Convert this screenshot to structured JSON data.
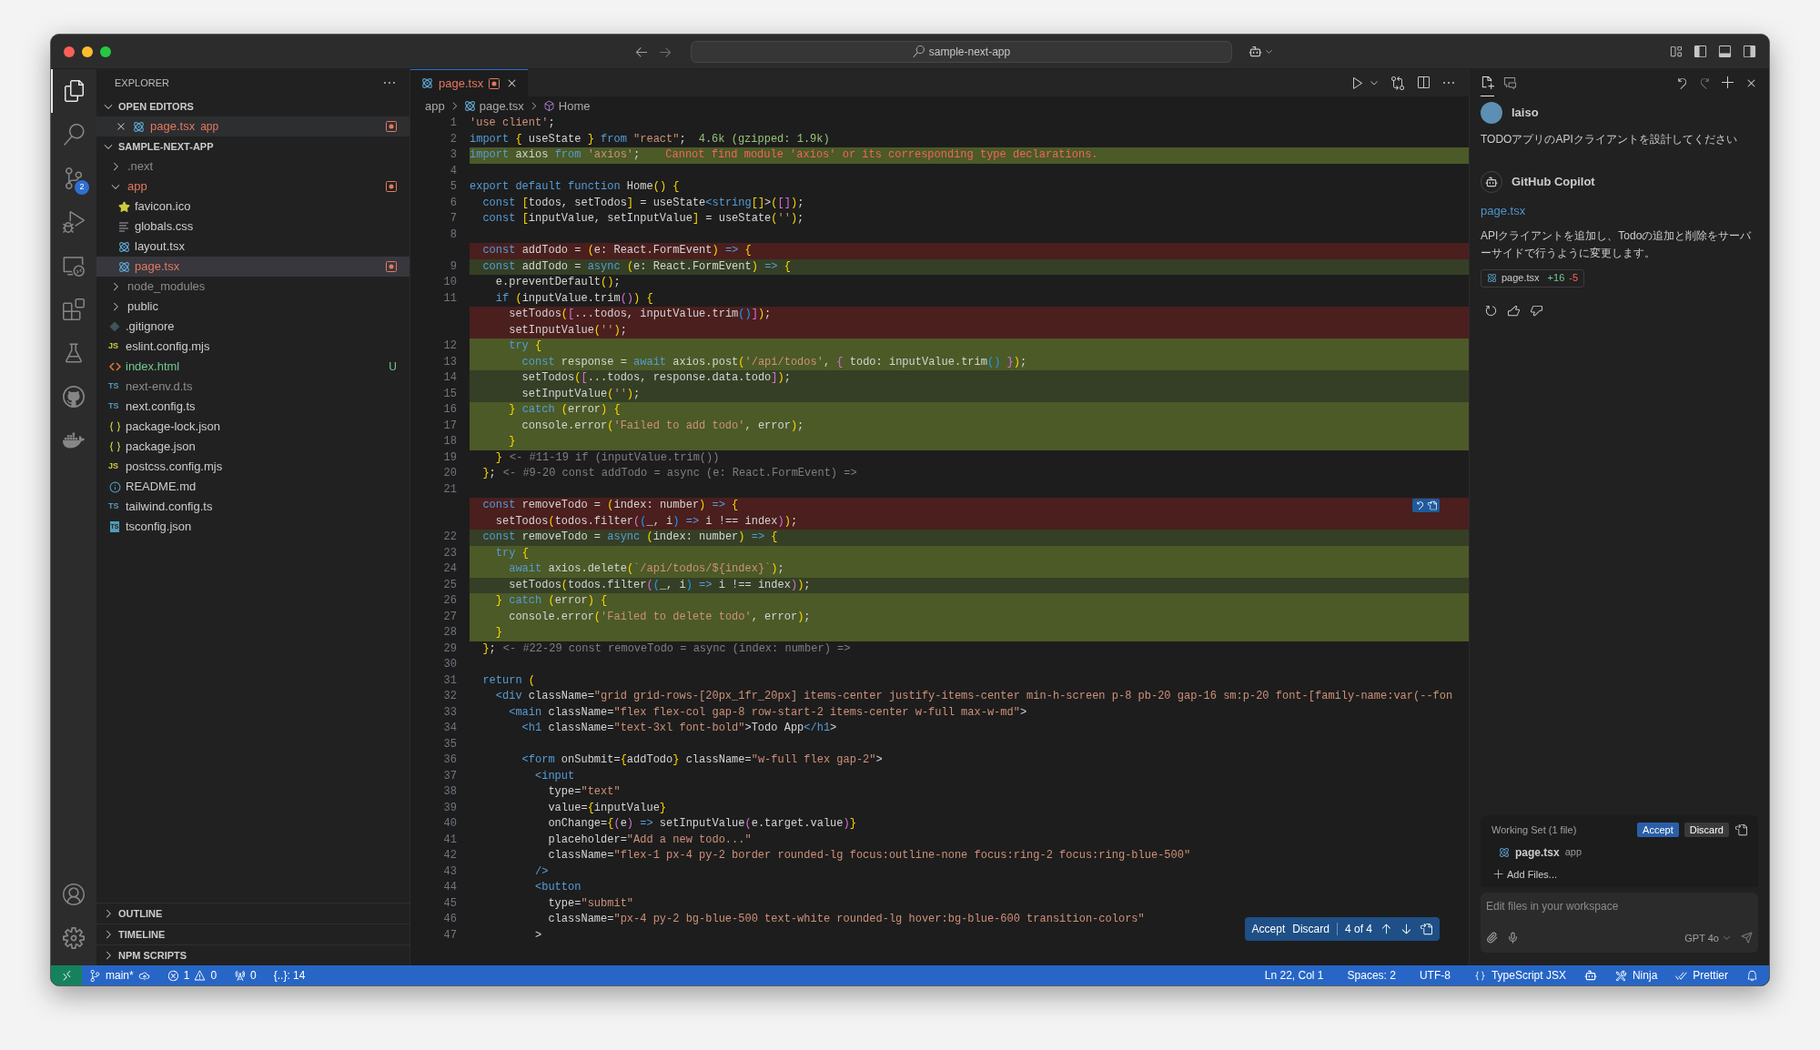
{
  "window": {
    "search": "sample-next-app"
  },
  "activity_bar": {
    "items": [
      {
        "kind": "explorer",
        "selected": true
      },
      {
        "kind": "search",
        "selected": false
      },
      {
        "kind": "source_control",
        "selected": false,
        "badge": "2"
      },
      {
        "kind": "run",
        "selected": false
      },
      {
        "kind": "remote",
        "selected": false
      },
      {
        "kind": "extensions",
        "selected": false
      },
      {
        "kind": "testing",
        "selected": false
      },
      {
        "kind": "github",
        "selected": false
      },
      {
        "kind": "docker",
        "selected": false
      }
    ],
    "bottom": [
      {
        "kind": "account"
      },
      {
        "kind": "settings"
      }
    ]
  },
  "sidebar": {
    "title": "EXPLORER",
    "open_editors": {
      "title": "OPEN EDITORS",
      "expanded": true,
      "items": [
        {
          "name": "page.tsx",
          "description": "app",
          "kind": "tsx",
          "modified": true,
          "selected": true
        }
      ]
    },
    "project": {
      "title": "SAMPLE-NEXT-APP",
      "expanded": true,
      "items": [
        {
          "name": ".next",
          "kind": "folder",
          "expanded": false,
          "modified": false,
          "untracked": false,
          "ignored": true,
          "selected": false
        },
        {
          "name": "app",
          "kind": "folder",
          "expanded": true,
          "modified": true,
          "untracked": false,
          "ignored": false,
          "selected": false,
          "children": [
            {
              "name": "favicon.ico",
              "kind": "ico",
              "modified": false,
              "untracked": false,
              "ignored": false,
              "selected": false
            },
            {
              "name": "globals.css",
              "kind": "css",
              "modified": false,
              "untracked": false,
              "ignored": false,
              "selected": false
            },
            {
              "name": "layout.tsx",
              "kind": "tsx",
              "modified": false,
              "untracked": false,
              "ignored": false,
              "selected": false
            },
            {
              "name": "page.tsx",
              "kind": "tsx",
              "modified": true,
              "untracked": false,
              "ignored": false,
              "selected": true
            }
          ]
        },
        {
          "name": "node_modules",
          "kind": "folder",
          "expanded": false,
          "modified": false,
          "untracked": false,
          "ignored": true,
          "selected": false
        },
        {
          "name": "public",
          "kind": "folder",
          "expanded": false,
          "modified": false,
          "untracked": false,
          "ignored": false,
          "selected": false
        },
        {
          "name": ".gitignore",
          "kind": "gitignore",
          "modified": false,
          "untracked": false,
          "ignored": false,
          "selected": false
        },
        {
          "name": "eslint.config.mjs",
          "kind": "js",
          "icon_text": "JS",
          "modified": false,
          "untracked": false,
          "ignored": false,
          "selected": false
        },
        {
          "name": "index.html",
          "kind": "html",
          "modified": false,
          "untracked": true,
          "ignored": false,
          "badge": "U",
          "selected": false
        },
        {
          "name": "next-env.d.ts",
          "kind": "ts",
          "icon_text": "TS",
          "modified": false,
          "untracked": false,
          "ignored": true,
          "selected": false
        },
        {
          "name": "next.config.ts",
          "kind": "ts",
          "icon_text": "TS",
          "modified": false,
          "untracked": false,
          "ignored": false,
          "selected": false
        },
        {
          "name": "package-lock.json",
          "kind": "json",
          "modified": false,
          "untracked": false,
          "ignored": false,
          "selected": false
        },
        {
          "name": "package.json",
          "kind": "json",
          "modified": false,
          "untracked": false,
          "ignored": false,
          "selected": false
        },
        {
          "name": "postcss.config.mjs",
          "kind": "js",
          "icon_text": "JS",
          "modified": false,
          "untracked": false,
          "ignored": false,
          "selected": false
        },
        {
          "name": "README.md",
          "kind": "md",
          "modified": false,
          "untracked": false,
          "ignored": false,
          "selected": false
        },
        {
          "name": "tailwind.config.ts",
          "kind": "ts",
          "icon_text": "TS",
          "modified": false,
          "untracked": false,
          "ignored": false,
          "selected": false
        },
        {
          "name": "tsconfig.json",
          "kind": "tsconfig",
          "icon_text": "TS",
          "modified": false,
          "untracked": false,
          "ignored": false,
          "selected": false
        }
      ]
    },
    "sections": [
      {
        "title": "OUTLINE",
        "expanded": false
      },
      {
        "title": "TIMELINE",
        "expanded": false
      },
      {
        "title": "NPM SCRIPTS",
        "expanded": false
      }
    ]
  },
  "editor": {
    "tab": {
      "name": "page.tsx",
      "modified": true,
      "selected": true
    },
    "breadcrumb": [
      {
        "label": "app"
      },
      {
        "label": "page.tsx",
        "kind": "tsx"
      },
      {
        "label": "Home",
        "kind": "function"
      }
    ],
    "rows": [
      {
        "n": "1",
        "kind": "normal",
        "text": "'use client';"
      },
      {
        "n": "2",
        "kind": "normal",
        "text": "import { useState } from \"react\";",
        "hint": "4.6k (gzipped: 1.9k)"
      },
      {
        "n": "3",
        "kind": "added",
        "text": "import axios from 'axios';",
        "error": "Cannot find module 'axios' or its corresponding type declarations."
      },
      {
        "n": "4",
        "kind": "normal"
      },
      {
        "n": "5",
        "kind": "normal",
        "text": "export default function Home() {"
      },
      {
        "n": "6",
        "kind": "normal",
        "text": "  const [todos, setTodos] = useState<string[]>([]);"
      },
      {
        "n": "7",
        "kind": "normal",
        "text": "  const [inputValue, setInputValue] = useState('');"
      },
      {
        "n": "8",
        "kind": "normal"
      },
      {
        "kind": "deleted",
        "text": "  const addTodo = (e: React.FormEvent) => {"
      },
      {
        "n": "9",
        "kind": "modified",
        "text": "  const addTodo = async (e: React.FormEvent) => {"
      },
      {
        "n": "10",
        "kind": "normal",
        "text": "    e.preventDefault();"
      },
      {
        "n": "11",
        "kind": "normal",
        "text": "    if (inputValue.trim()) {"
      },
      {
        "kind": "deleted",
        "text": "      setTodos([...todos, inputValue.trim()]);"
      },
      {
        "kind": "deleted",
        "text": "      setInputValue('');"
      },
      {
        "n": "12",
        "kind": "added",
        "text": "      try {"
      },
      {
        "n": "13",
        "kind": "added",
        "text": "        const response = await axios.post('/api/todos', { todo: inputValue.trim() });"
      },
      {
        "n": "14",
        "kind": "modified",
        "text": "        setTodos([...todos, response.data.todo]);"
      },
      {
        "n": "15",
        "kind": "modified",
        "text": "        setInputValue('');"
      },
      {
        "n": "16",
        "kind": "added",
        "text": "      } catch (error) {"
      },
      {
        "n": "17",
        "kind": "added",
        "text": "        console.error('Failed to add todo', error);"
      },
      {
        "n": "18",
        "kind": "added",
        "text": "      }"
      },
      {
        "n": "19",
        "kind": "normal",
        "text": "    }",
        "annotation": "<- #11-19 if (inputValue.trim())"
      },
      {
        "n": "20",
        "kind": "normal",
        "text": "  };",
        "annotation": "<- #9-20 const addTodo = async (e: React.FormEvent) =>"
      },
      {
        "n": "21",
        "kind": "normal"
      },
      {
        "kind": "deleted",
        "hunk_actions": true,
        "text": "  const removeTodo = (index: number) => {"
      },
      {
        "kind": "deleted",
        "text": "    setTodos(todos.filter((_, i) => i !== index));"
      },
      {
        "n": "22",
        "kind": "modified",
        "text": "  const removeTodo = async (index: number) => {"
      },
      {
        "n": "23",
        "kind": "added",
        "text": "    try {"
      },
      {
        "n": "24",
        "kind": "added",
        "text": "      await axios.delete(`/api/todos/${index}`);"
      },
      {
        "n": "25",
        "kind": "modified",
        "text": "      setTodos(todos.filter((_, i) => i !== index));"
      },
      {
        "n": "26",
        "kind": "added",
        "text": "    } catch (error) {"
      },
      {
        "n": "27",
        "kind": "added",
        "text": "      console.error('Failed to delete todo', error);"
      },
      {
        "n": "28",
        "kind": "added",
        "text": "    }"
      },
      {
        "n": "29",
        "kind": "normal",
        "text": "  };",
        "annotation": "<- #22-29 const removeTodo = async (index: number) =>"
      },
      {
        "n": "30",
        "kind": "normal"
      },
      {
        "n": "31",
        "kind": "normal",
        "text": "  return ("
      },
      {
        "n": "32",
        "kind": "normal",
        "text": "    <div className=\"grid grid-rows-[20px_1fr_20px] items-center justify-items-center min-h-screen p-8 pb-20 gap-16 sm:p-20 font-[family-name:var(--fon"
      },
      {
        "n": "33",
        "kind": "normal",
        "text": "      <main className=\"flex flex-col gap-8 row-start-2 items-center w-full max-w-md\">"
      },
      {
        "n": "34",
        "kind": "normal",
        "text": "        <h1 className=\"text-3xl font-bold\">Todo App</h1>"
      },
      {
        "n": "35",
        "kind": "normal"
      },
      {
        "n": "36",
        "kind": "normal",
        "text": "        <form onSubmit={addTodo} className=\"w-full flex gap-2\">"
      },
      {
        "n": "37",
        "kind": "normal",
        "text": "          <input"
      },
      {
        "n": "38",
        "kind": "normal",
        "text": "            type=\"text\""
      },
      {
        "n": "39",
        "kind": "normal",
        "text": "            value={inputValue}"
      },
      {
        "n": "40",
        "kind": "normal",
        "text": "            onChange={(e) => setInputValue(e.target.value)}"
      },
      {
        "n": "41",
        "kind": "normal",
        "text": "            placeholder=\"Add a new todo...\""
      },
      {
        "n": "42",
        "kind": "normal",
        "text": "            className=\"flex-1 px-4 py-2 border rounded-lg focus:outline-none focus:ring-2 focus:ring-blue-500\""
      },
      {
        "n": "43",
        "kind": "normal",
        "text": "          />"
      },
      {
        "n": "44",
        "kind": "normal",
        "text": "          <button"
      },
      {
        "n": "45",
        "kind": "normal",
        "text": "            type=\"submit\""
      },
      {
        "n": "46",
        "kind": "normal",
        "text": "            className=\"px-4 py-2 bg-blue-500 text-white rounded-lg hover:bg-blue-600 transition-colors\""
      },
      {
        "n": "47",
        "kind": "normal",
        "text": "          >"
      }
    ],
    "review_bar": {
      "accept": "Accept",
      "discard": "Discard",
      "counter": "4 of 4"
    }
  },
  "chat": {
    "tabs": [
      {
        "kind": "edits",
        "selected": true
      },
      {
        "kind": "chat",
        "selected": false
      }
    ],
    "user": {
      "name": "laiso",
      "text": "TODOアプリのAPIクライアントを設計してください"
    },
    "assistant": {
      "name": "GitHub Copilot",
      "link": "page.tsx",
      "text": "APIクライアントを追加し、Todoの追加と削除をサーバーサイドで行うように変更します。",
      "file": {
        "name": "page.tsx",
        "added": "+16",
        "removed": "-5"
      }
    },
    "working_set": {
      "title": "Working Set (1 file)",
      "accept": "Accept",
      "discard": "Discard",
      "file": {
        "name": "page.tsx",
        "description": "app"
      },
      "add_files": "Add Files..."
    },
    "input": {
      "placeholder": "Edit files in your workspace",
      "model": "GPT 4o"
    }
  },
  "status_bar": {
    "branch": "main*",
    "errors": "1",
    "warnings": "0",
    "ports": "0",
    "symbols": "{..}: 14",
    "position": "Ln 22, Col 1",
    "indent": "Spaces: 2",
    "encoding": "UTF-8",
    "language": "TypeScript JSX",
    "ninja": "Ninja",
    "prettier": "Prettier"
  }
}
